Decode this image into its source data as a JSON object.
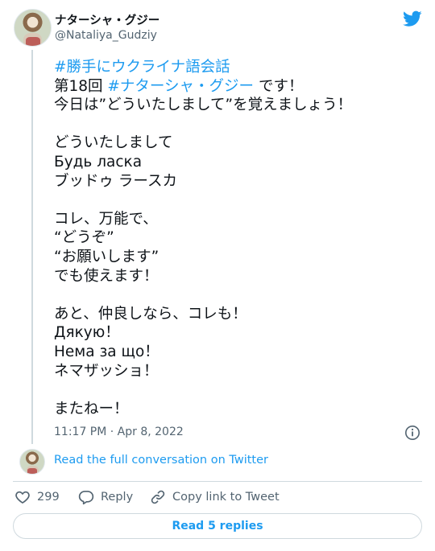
{
  "author": {
    "name": "ナターシャ・グジー",
    "handle": "@Nataliya_Gudziy"
  },
  "tweet": {
    "lines": [
      [
        {
          "text": "#勝手にウクライナ語会話",
          "hashtag": true
        }
      ],
      [
        {
          "text": "第18回 "
        },
        {
          "text": "#ナターシャ・グジー",
          "hashtag": true
        },
        {
          "text": " です！"
        }
      ],
      [
        {
          "text": "今日は”どういたしまして”を覚えましょう！"
        }
      ],
      [
        {
          "text": ""
        }
      ],
      [
        {
          "text": "どういたしまして"
        }
      ],
      [
        {
          "text": "Будь ласка"
        }
      ],
      [
        {
          "text": "ブッドゥ ラースカ"
        }
      ],
      [
        {
          "text": ""
        }
      ],
      [
        {
          "text": "コレ、万能で、"
        }
      ],
      [
        {
          "text": "“どうぞ”"
        }
      ],
      [
        {
          "text": "“お願いします”"
        }
      ],
      [
        {
          "text": "でも使えます！"
        }
      ],
      [
        {
          "text": ""
        }
      ],
      [
        {
          "text": "あと、仲良しなら、コレも！"
        }
      ],
      [
        {
          "text": "Дякую！"
        }
      ],
      [
        {
          "text": "Нема за що！"
        }
      ],
      [
        {
          "text": "ネマザッショ！"
        }
      ],
      [
        {
          "text": ""
        }
      ],
      [
        {
          "text": "またねー！"
        }
      ]
    ],
    "timestamp": "11:17 PM · Apr 8, 2022"
  },
  "thread": {
    "read_conversation": "Read the full conversation on Twitter"
  },
  "actions": {
    "like_count": "299",
    "reply_label": "Reply",
    "copy_label": "Copy link to Tweet"
  },
  "footer": {
    "read_replies": "Read 5 replies"
  },
  "colors": {
    "accent": "#1d9bf0",
    "text": "#0f1419",
    "muted": "#536471",
    "border": "#cfd9de"
  },
  "icons": [
    "twitter-bird-icon",
    "info-icon",
    "heart-icon",
    "reply-bubble-icon",
    "link-icon"
  ]
}
